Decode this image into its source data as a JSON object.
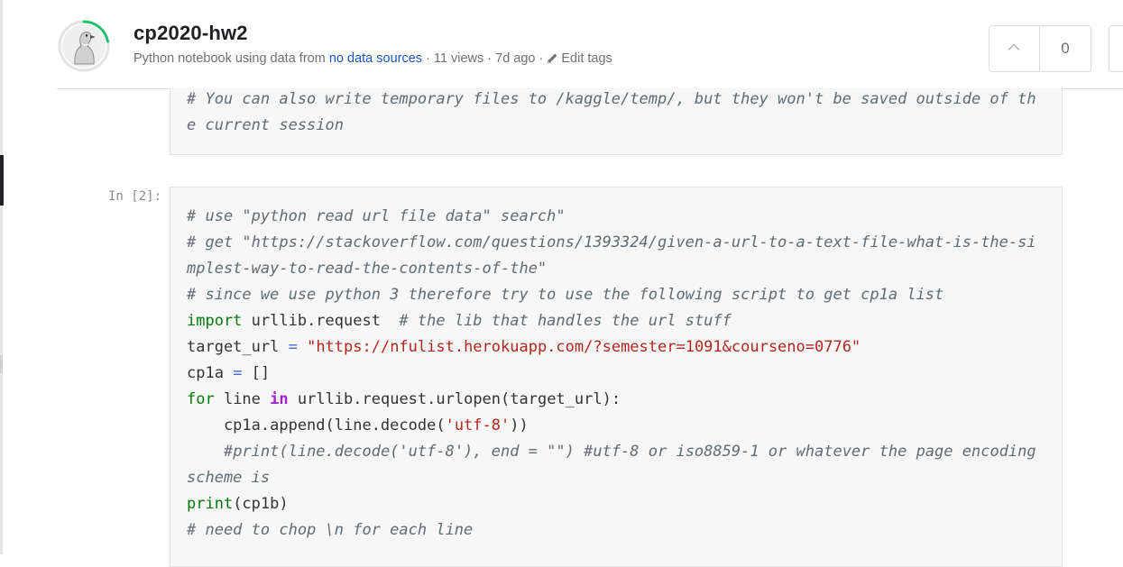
{
  "header": {
    "title": "cp2020-hw2",
    "meta_prefix": "Python notebook using data from",
    "meta_link": "no data sources",
    "meta_stats": "· 11 views · 7d ago ·",
    "edit_tags": "Edit tags",
    "vote_count": "0"
  },
  "cells": {
    "top": {
      "lines": [
        "# You can also write temporary files to /kaggle/temp/, but they won't be saved outside of th",
        "e current session"
      ]
    },
    "main": {
      "prompt": "In [2]:",
      "comments": {
        "c1": "# use \"python read url file data\" search\"",
        "c2": "# get \"https://stackoverflow.com/questions/1393324/given-a-url-to-a-text-file-what-is-the-si",
        "c3": "mplest-way-to-read-the-contents-of-the\"",
        "c4": "# since we use python 3 therefore try to use the following script to get cp1a list",
        "c5": "# the lib that handles the url stuff",
        "c6": "#print(line.decode('utf-8'), end = \"\") #utf-8 or iso8859-1 or whatever the page encoding",
        "c7": "scheme is",
        "c8": "# need to chop \\n for each line"
      },
      "tokens": {
        "import": "import",
        "module": " urllib.request  ",
        "target_var": "target_url ",
        "eq": "=",
        "url_string": " \"https://nfulist.herokuapp.com/?semester=1091&courseno=0776\"",
        "cp1a_var": "cp1a ",
        "empty_list": " []",
        "for": "for",
        "line_var": " line ",
        "in": "in",
        "urlopen_call": " urllib.request.urlopen(target_url):",
        "append_call": "    cp1a.append(line.decode(",
        "utf8": "'utf-8'",
        "close_paren": "))",
        "indent": "    ",
        "print": "print",
        "print_args": "(cp1b)"
      }
    }
  }
}
